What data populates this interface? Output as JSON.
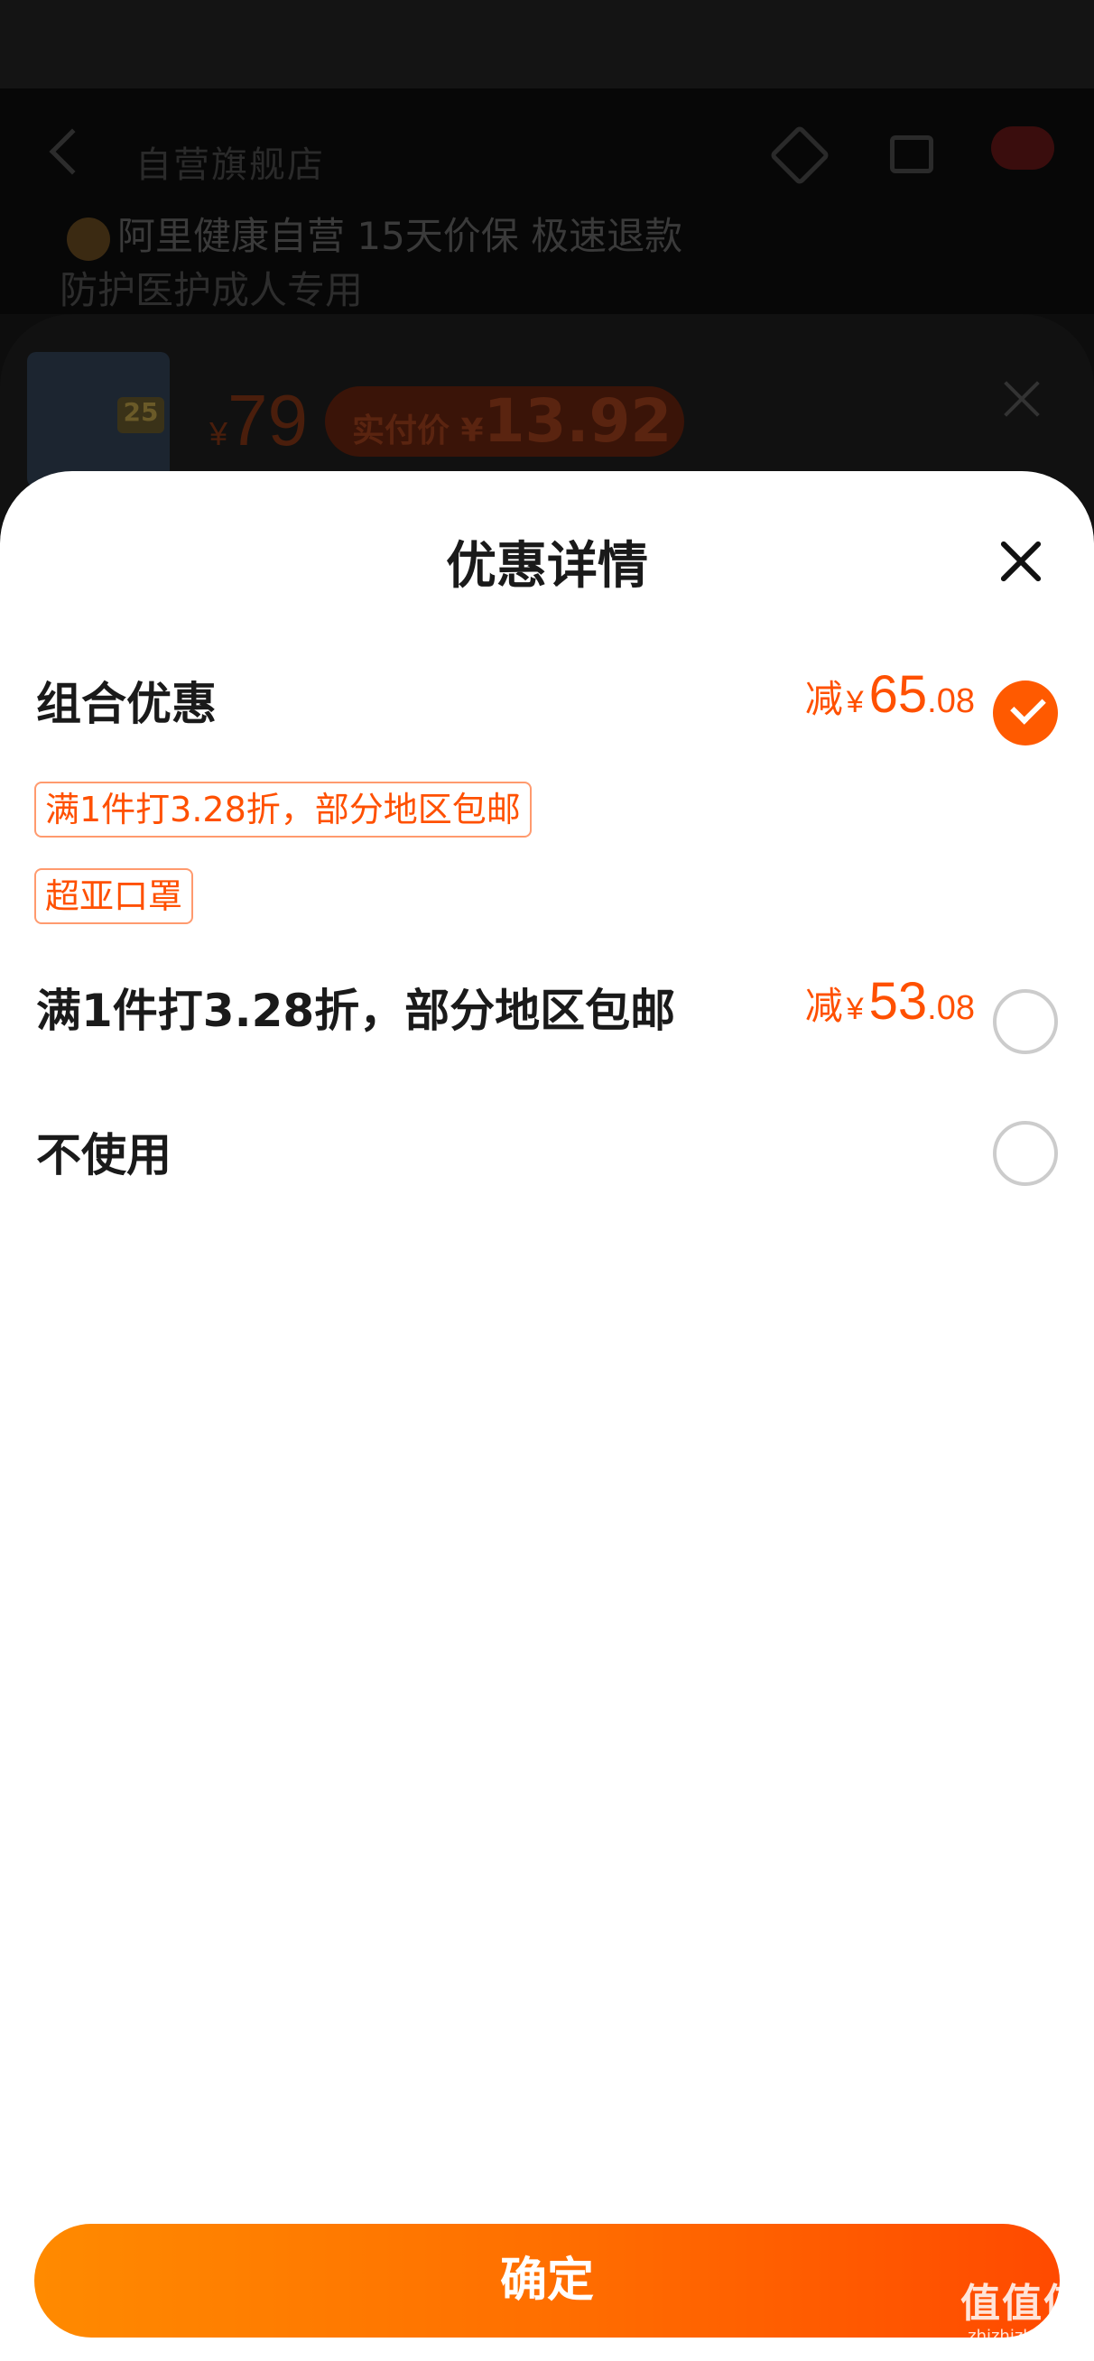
{
  "background": {
    "title_blurred": "自营旗舰店",
    "store_line": "阿里健康自营 15天价保 极速退款",
    "product_line2": "防护医护成人专用",
    "thumb_badge": "25",
    "price_symbol": "¥",
    "price": "79",
    "real_price_label": "实付价 ¥",
    "real_price": "13.92"
  },
  "sheet": {
    "title": "优惠详情"
  },
  "options": [
    {
      "label": "组合优惠",
      "prefix": "减",
      "currency": "¥",
      "amount_int": "65",
      "amount_dec": ".08",
      "selected": true,
      "tags": [
        "满1件打3.28折，部分地区包邮",
        "超亚口罩"
      ]
    },
    {
      "label": "满1件打3.28折，部分地区包邮",
      "prefix": "减",
      "currency": "¥",
      "amount_int": "53",
      "amount_dec": ".08",
      "selected": false
    },
    {
      "label": "不使用",
      "selected": false
    }
  ],
  "confirm_label": "确定",
  "watermark": {
    "mark": "值值值",
    "url": "zhizhizhi.com"
  },
  "colors": {
    "accent": "#ff5000",
    "button_gradient_start": "#ff8a00",
    "button_gradient_end": "#ff4a00",
    "tag_border": "#ff9a6e"
  }
}
